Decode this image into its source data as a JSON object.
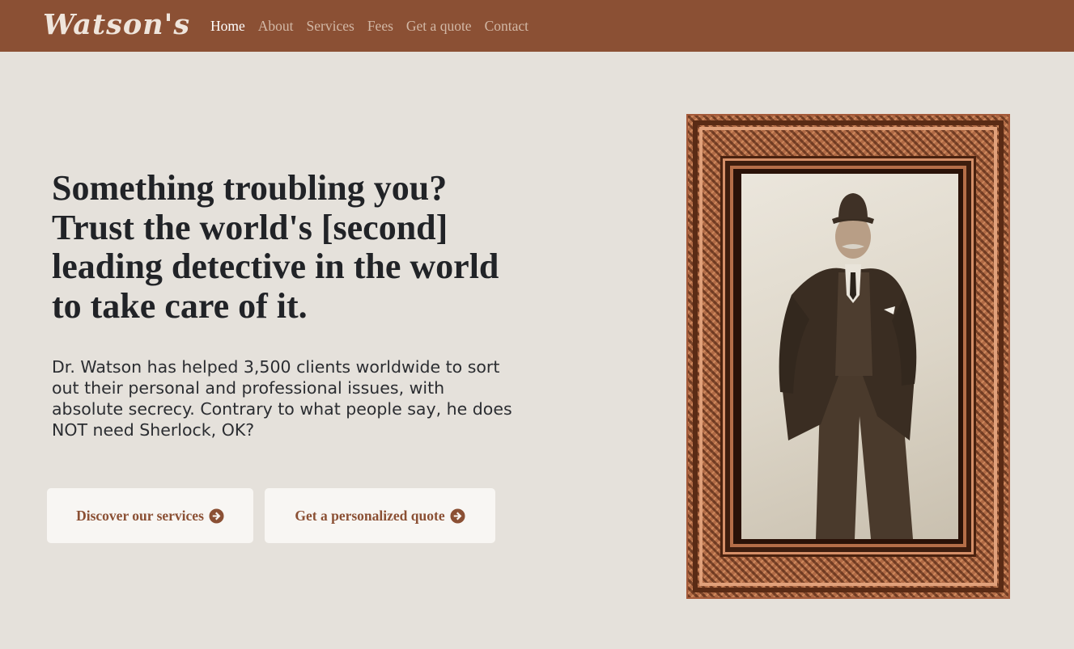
{
  "navbar": {
    "brand": "Watson's",
    "links": [
      {
        "label": "Home",
        "active": true
      },
      {
        "label": "About"
      },
      {
        "label": "Services"
      },
      {
        "label": "Fees"
      },
      {
        "label": "Get a quote"
      },
      {
        "label": "Contact"
      }
    ]
  },
  "hero": {
    "headline": "Something troubling you? Trust the world's [second] leading detective in the world to take care of it.",
    "lead": "Dr. Watson has helped 3,500 clients worldwide to sort out their personal and professional issues, with absolute secrecy. Contrary to what people say, he does NOT need Sherlock, OK?",
    "buttons": [
      {
        "label": "Discover our services",
        "icon": "arrow-circle-right-icon"
      },
      {
        "label": "Get a personalized quote",
        "icon": "arrow-circle-right-icon"
      }
    ],
    "portrait": {
      "description_icon": "framed-portrait-photo"
    }
  },
  "colors": {
    "navbar_bg": "#8b5034",
    "page_bg": "#e5e1db",
    "accent": "#8b5034",
    "button_bg": "#f8f6f3",
    "text_dark": "#212327"
  }
}
